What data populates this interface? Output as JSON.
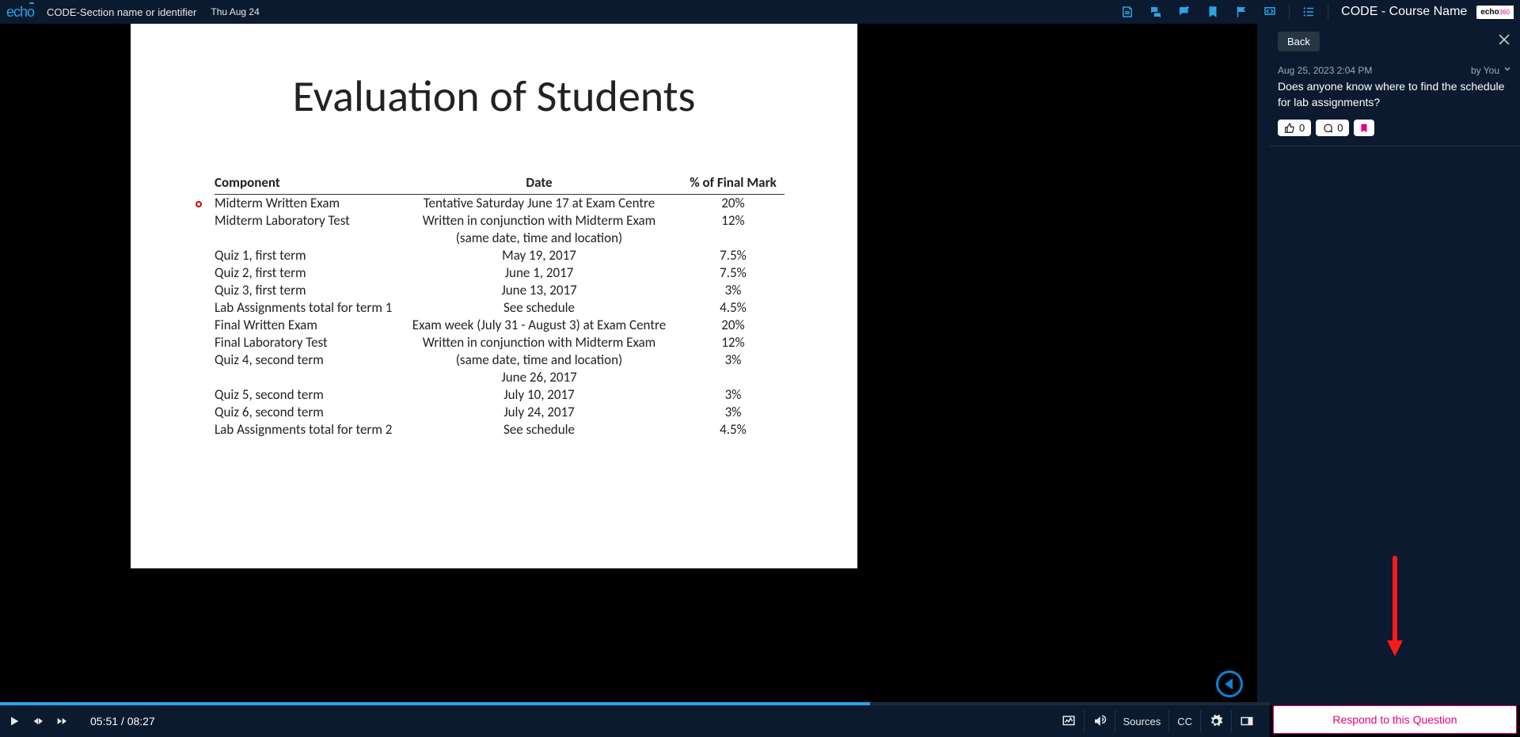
{
  "header": {
    "brand": "echo",
    "section": "CODE-Section name or identifier",
    "date": "Thu Aug 24",
    "course": "CODE - Course Name",
    "badge": "echo",
    "badge_suffix": "360"
  },
  "slide": {
    "title": "Evaluation of Students",
    "columns": [
      "Component",
      "Date",
      "% of Final Mark"
    ],
    "rows": [
      {
        "c1": "Midterm Written Exam",
        "c2": "Tentative Saturday June 17 at Exam Centre",
        "c3": "20%"
      },
      {
        "c1": "Midterm Laboratory Test",
        "c2": "Written in conjunction with Midterm Exam",
        "c3": "12%"
      },
      {
        "c1": "",
        "c2": "(same date, time and location)",
        "c3": ""
      },
      {
        "c1": "Quiz 1, first term",
        "c2": "May 19, 2017",
        "c3": "7.5%"
      },
      {
        "c1": "Quiz 2, first term",
        "c2": "June 1, 2017",
        "c3": "7.5%"
      },
      {
        "c1": "Quiz 3, first term",
        "c2": "June 13, 2017",
        "c3": "3%"
      },
      {
        "c1": "Lab Assignments total for term 1",
        "c2": "See schedule",
        "c3": "4.5%"
      },
      {
        "c1": "Final Written Exam",
        "c2": "Exam week (July 31 - August 3) at Exam Centre",
        "c3": "20%"
      },
      {
        "c1": "Final Laboratory Test",
        "c2": "Written in conjunction with Midterm Exam",
        "c3": "12%"
      },
      {
        "c1": "Quiz 4, second term",
        "c2": "(same date, time and location)",
        "c3": "3%"
      },
      {
        "c1": "",
        "c2": "June 26, 2017",
        "c3": ""
      },
      {
        "c1": "Quiz 5, second term",
        "c2": "July 10, 2017",
        "c3": "3%"
      },
      {
        "c1": "Quiz 6, second term",
        "c2": "July 24, 2017",
        "c3": "3%"
      },
      {
        "c1": "Lab Assignments total for term 2",
        "c2": "See schedule",
        "c3": "4.5%"
      }
    ]
  },
  "panel": {
    "back": "Back",
    "timestamp": "Aug 25, 2023 2:04 PM",
    "byline": "by You",
    "question": "Does anyone know where to find the schedule for lab assignments?",
    "like_count": "0",
    "reply_count": "0",
    "respond": "Respond to this Question"
  },
  "player": {
    "time_current": "05:51",
    "time_total": "08:27",
    "sources": "Sources",
    "cc": "CC",
    "progress_pct": 68.5
  }
}
